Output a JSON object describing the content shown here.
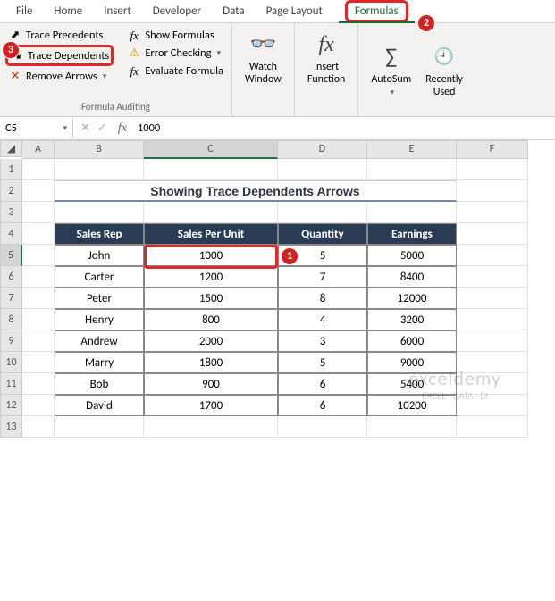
{
  "tabs": {
    "file": "File",
    "home": "Home",
    "insert": "Insert",
    "developer": "Developer",
    "data": "Data",
    "pagelayout": "Page Layout",
    "formulas": "Formulas"
  },
  "ribbon": {
    "trace_precedents": "Trace Precedents",
    "trace_dependents": "Trace Dependents",
    "remove_arrows": "Remove Arrows",
    "show_formulas": "Show Formulas",
    "error_checking": "Error Checking",
    "evaluate_formula": "Evaluate Formula",
    "audit_label": "Formula Auditing",
    "watch_window": "Watch\nWindow",
    "insert_function": "Insert\nFunction",
    "autosum": "AutoSum",
    "recently_used": "Recently\nUsed"
  },
  "namebox": "C5",
  "formula_value": "1000",
  "cols": [
    "A",
    "B",
    "C",
    "D",
    "E",
    "F"
  ],
  "rows": [
    "1",
    "2",
    "3",
    "4",
    "5",
    "6",
    "7",
    "8",
    "9",
    "10",
    "11",
    "12",
    "13"
  ],
  "title": "Showing Trace Dependents Arrows",
  "headers": {
    "b": "Sales Rep",
    "c": "Sales Per Unit",
    "d": "Quantity",
    "e": "Earnings"
  },
  "chart_data": {
    "type": "table",
    "columns": [
      "Sales Rep",
      "Sales Per Unit",
      "Quantity",
      "Earnings"
    ],
    "rows": [
      {
        "rep": "John",
        "unit": 1000,
        "qty": 5,
        "earn": 5000
      },
      {
        "rep": "Carter",
        "unit": 1200,
        "qty": 7,
        "earn": 8400
      },
      {
        "rep": "Peter",
        "unit": 1500,
        "qty": 8,
        "earn": 12000
      },
      {
        "rep": "Henry",
        "unit": 800,
        "qty": 4,
        "earn": 3200
      },
      {
        "rep": "Andrew",
        "unit": 2000,
        "qty": 3,
        "earn": 6000
      },
      {
        "rep": "Marry",
        "unit": 1800,
        "qty": 5,
        "earn": 9000
      },
      {
        "rep": "Bob",
        "unit": 900,
        "qty": 6,
        "earn": 5400
      },
      {
        "rep": "David",
        "unit": 1700,
        "qty": 6,
        "earn": 10200
      }
    ]
  },
  "watermark": {
    "line1": "exceldemy",
    "line2": "EXCEL · DATA · BI"
  },
  "badges": {
    "b1": "1",
    "b2": "2",
    "b3": "3"
  }
}
